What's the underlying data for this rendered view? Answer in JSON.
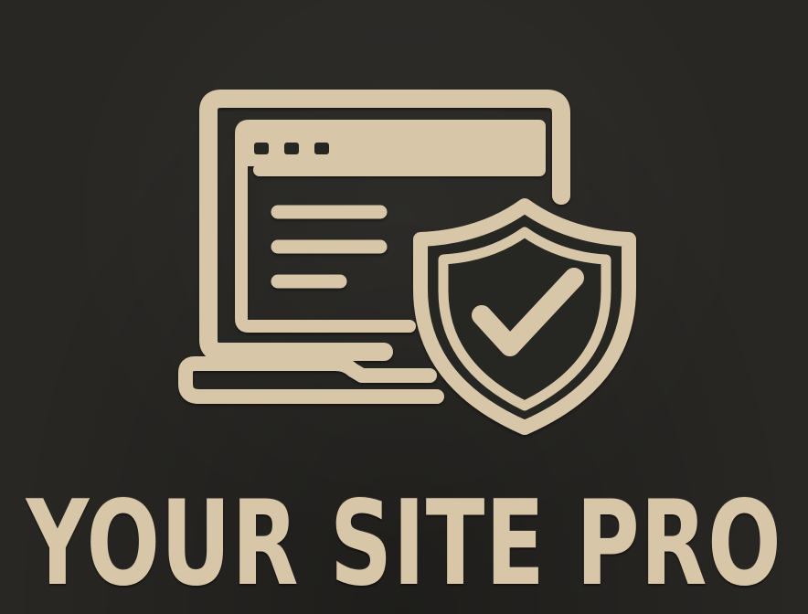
{
  "brand": {
    "name": "YOUR SITE PRO",
    "color": "#d8c6a8",
    "background": "#282724"
  },
  "emblem": {
    "icons": [
      "laptop-icon",
      "browser-window-icon",
      "shield-icon",
      "checkmark-icon"
    ]
  }
}
